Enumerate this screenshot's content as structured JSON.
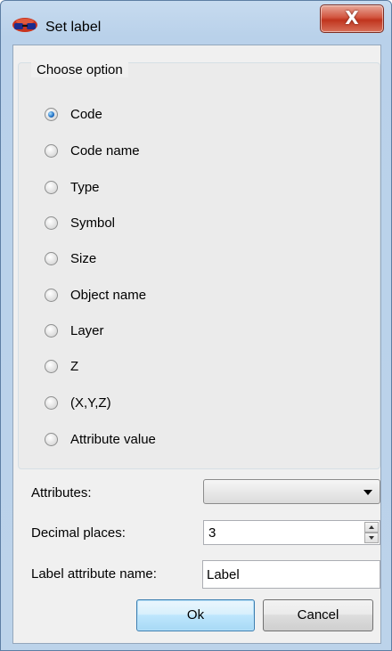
{
  "window": {
    "title": "Set label",
    "close_glyph": "X",
    "app_icon": "stereo-glasses-icon"
  },
  "options_group": {
    "legend": "Choose option",
    "selected": "Code",
    "items": [
      {
        "label": "Code",
        "checked": true
      },
      {
        "label": "Code name",
        "checked": false
      },
      {
        "label": "Type",
        "checked": false
      },
      {
        "label": "Symbol",
        "checked": false
      },
      {
        "label": "Size",
        "checked": false
      },
      {
        "label": "Object name",
        "checked": false
      },
      {
        "label": "Layer",
        "checked": false
      },
      {
        "label": "Z",
        "checked": false
      },
      {
        "label": "(X,Y,Z)",
        "checked": false
      },
      {
        "label": "Attribute value",
        "checked": false
      }
    ]
  },
  "fields": {
    "attributes_label": "Attributes:",
    "attributes_value": "",
    "decimal_label": "Decimal places:",
    "decimal_value": "3",
    "label_attr_label": "Label attribute name:",
    "label_attr_value": "Label"
  },
  "buttons": {
    "ok": "Ok",
    "cancel": "Cancel"
  }
}
